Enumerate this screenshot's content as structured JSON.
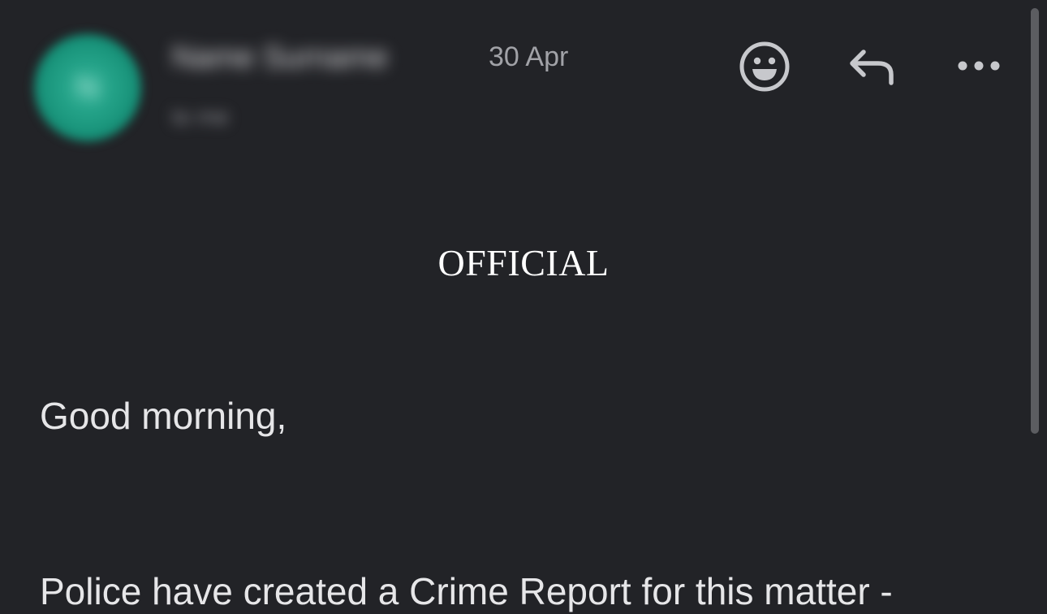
{
  "header": {
    "sender_name": "Name Surname",
    "sender_initial": "N",
    "recipient_line": "to me",
    "date": "30 Apr",
    "icons": {
      "reaction": "smile-icon",
      "reply": "reply-icon",
      "more": "more-horizontal-icon"
    }
  },
  "message": {
    "classification": "OFFICIAL",
    "greeting": "Good morning,",
    "body_line_1": "Police have created a Crime Report for this matter -"
  },
  "colors": {
    "background": "#222327",
    "avatar": "#1f9c82",
    "secondary_text": "#a1a2a7",
    "icon": "#c7c8cc"
  }
}
